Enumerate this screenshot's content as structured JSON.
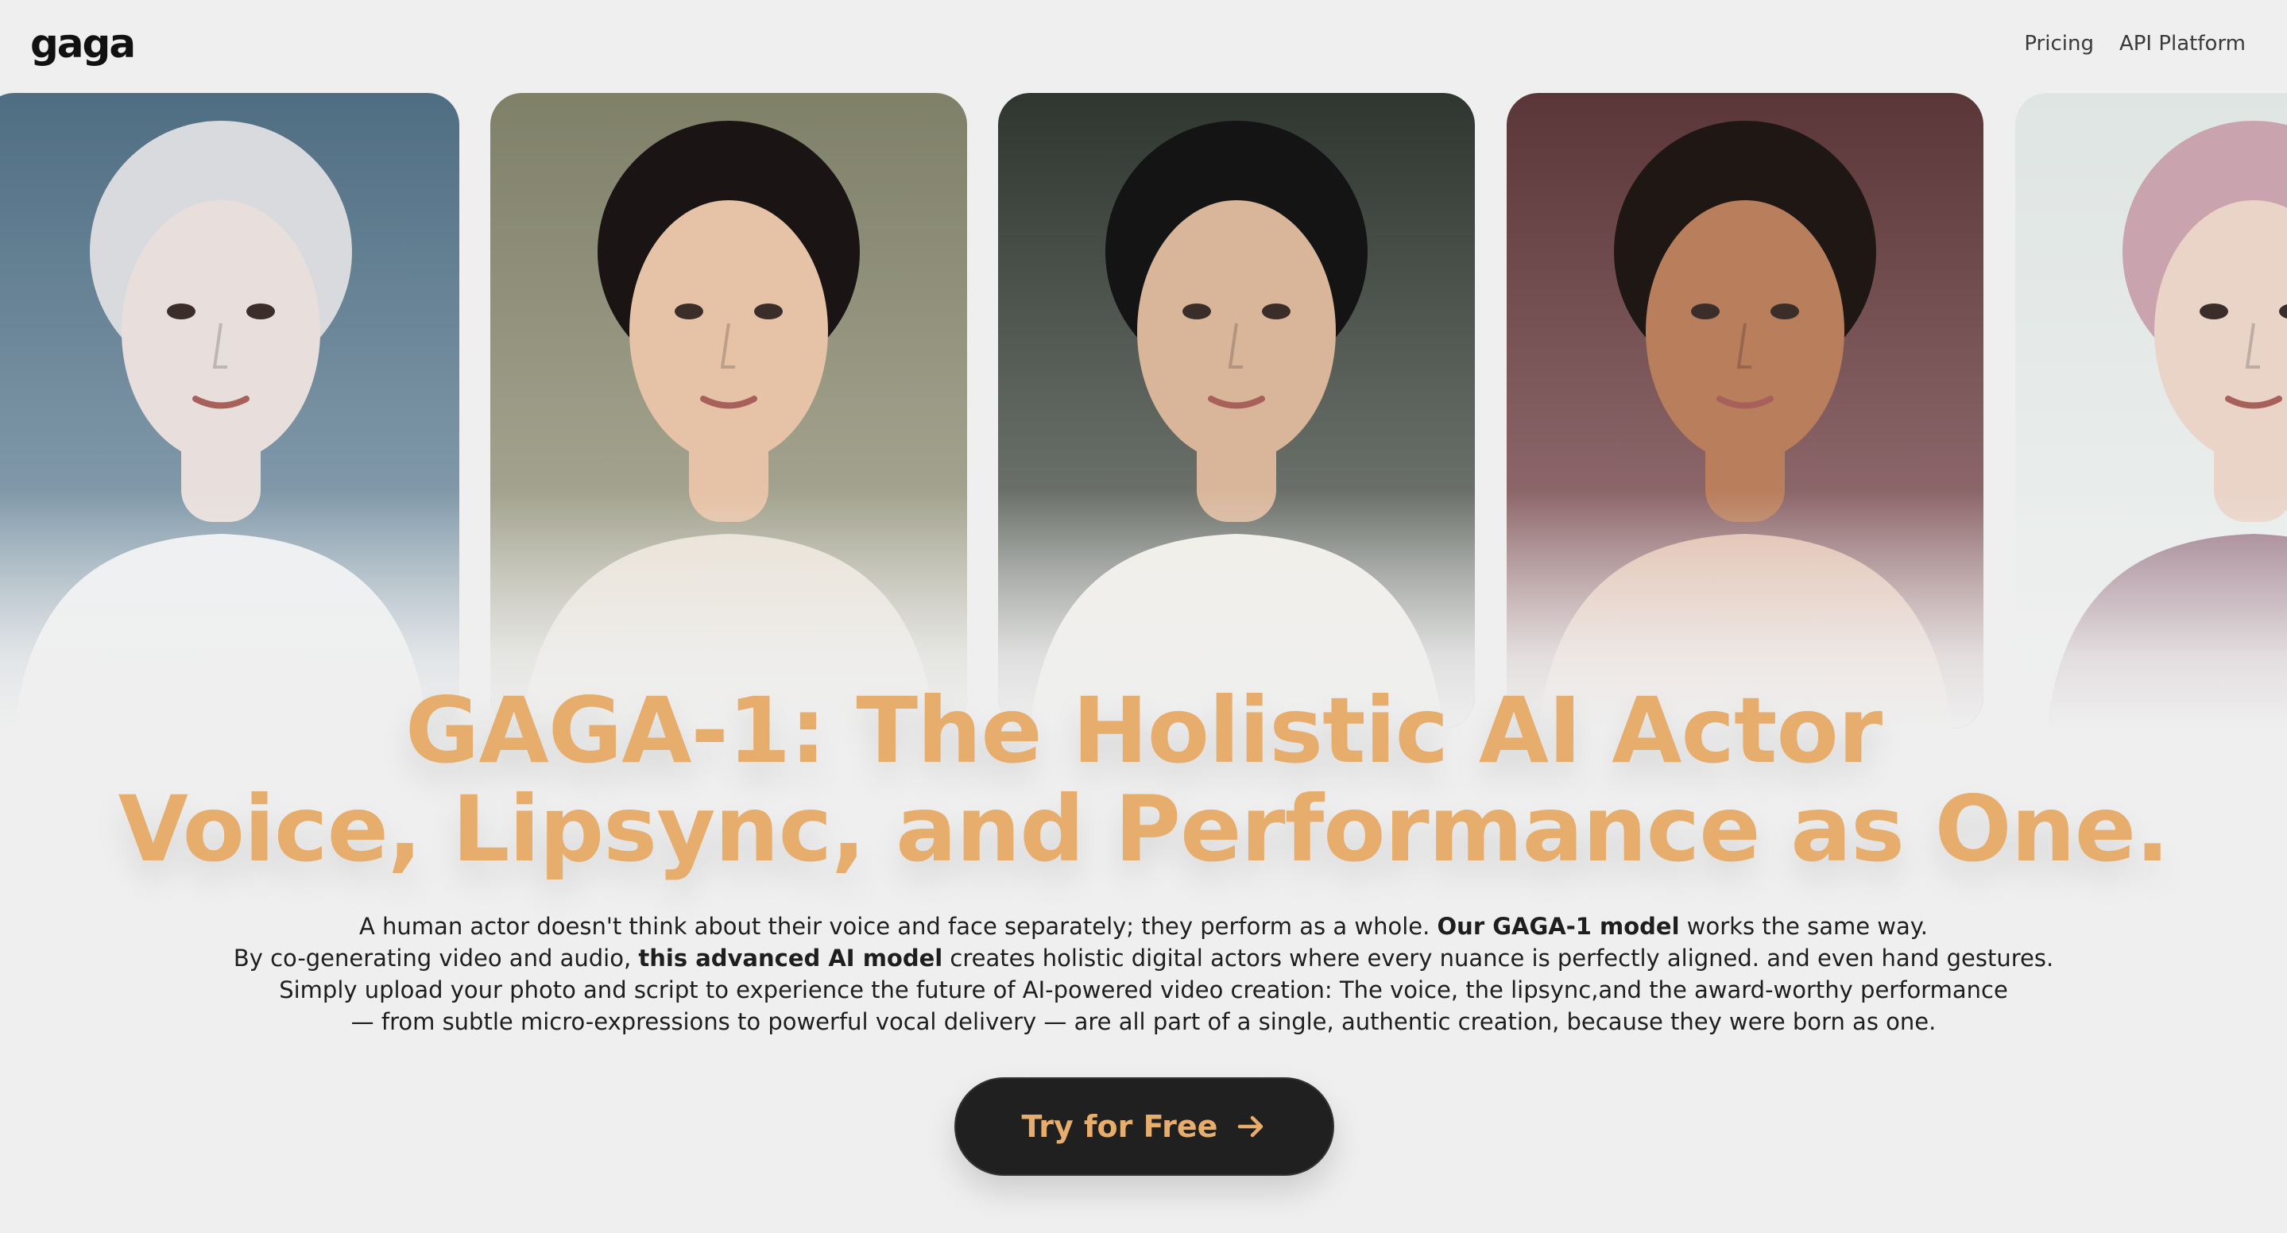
{
  "brand": {
    "logo": "gaga"
  },
  "nav": {
    "items": [
      {
        "label": "Pricing"
      },
      {
        "label": "API Platform"
      }
    ]
  },
  "hero": {
    "headline_line1": "GAGA-1: The Holistic AI Actor",
    "headline_line2": "Voice, Lipsync, and Performance as One.",
    "paragraph": [
      {
        "a": "A human actor doesn't think about their voice and face separately; they perform as a whole. ",
        "b": "Our GAGA-1 model",
        "c": " works the same way."
      },
      {
        "a": "By co-generating video and audio, ",
        "b": "this advanced AI model",
        "c": " creates holistic digital actors where every nuance is perfectly aligned. and even hand gestures."
      },
      {
        "a": "Simply upload your photo and script to experience the future of AI-powered video creation: The voice, the lipsync,and the award-worthy performance",
        "b": "",
        "c": ""
      },
      {
        "a": "— from subtle micro-expressions to powerful vocal delivery — are all part of a single, authentic creation, because they were born as one.",
        "b": "",
        "c": ""
      }
    ],
    "cta_label": "Try for Free",
    "cta_icon": "arrow-right-icon"
  },
  "portraits": [
    {
      "name": "portrait-silver-hair",
      "bg_top": "#4f6d82",
      "bg_bottom": "#9db2c0",
      "skin": "#e8dfdc",
      "hair": "#d8dadd",
      "clothes": "#eef1f3"
    },
    {
      "name": "portrait-dark-updo",
      "bg_top": "#7f8068",
      "bg_bottom": "#b7b6a4",
      "skin": "#e6c2a6",
      "hair": "#1a1414",
      "clothes": "#e9e1d3"
    },
    {
      "name": "portrait-wavy-hair",
      "bg_top": "#2f3630",
      "bg_bottom": "#8d918b",
      "skin": "#d9b69a",
      "hair": "#141414",
      "clothes": "#f1efe8"
    },
    {
      "name": "portrait-curly-updo",
      "bg_top": "#5a3638",
      "bg_bottom": "#a98286",
      "skin": "#b97e5c",
      "hair": "#1f1714",
      "clothes": "#e2bca9"
    },
    {
      "name": "portrait-pink-hood",
      "bg_top": "#dfe5e3",
      "bg_bottom": "#eef1f0",
      "skin": "#ead4c8",
      "hair": "#c9a3ae",
      "clothes": "#9c7a88"
    }
  ]
}
